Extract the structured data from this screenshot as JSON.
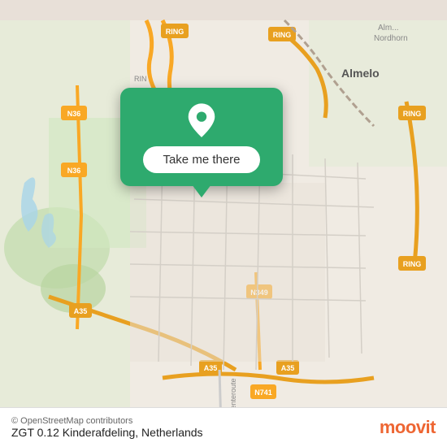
{
  "map": {
    "popup": {
      "button_label": "Take me there"
    },
    "pin_color": "#ffffff",
    "bg_color": "#2eaa6e"
  },
  "bottom_bar": {
    "location_title": "ZGT 0.12 Kinderafdeling, Netherlands",
    "osm_credit": "© OpenStreetMap contributors",
    "moovit_label": "moovit"
  }
}
